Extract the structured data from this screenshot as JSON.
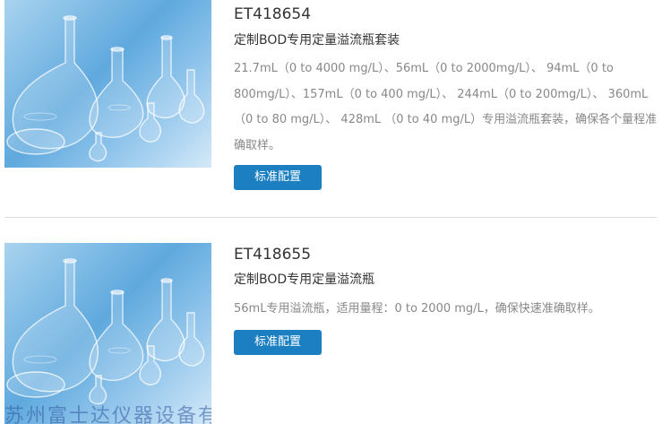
{
  "products": [
    {
      "code": "ET418654",
      "title": "定制BOD专用定量溢流瓶套装",
      "description": "21.7mL（0 to 4000 mg/L）、56mL（0 to 2000mg/L）、 94mL（0 to 800mg/L）、157mL（0 to 400 mg/L）、 244mL（0 to 200mg/L）、 360mL（0 to 80 mg/L）、 428mL （0 to 40 mg/L）专用溢流瓶套装，确保各个量程准确取样。",
      "button_label": "标准配置",
      "image_icon": "volumetric-flasks-image"
    },
    {
      "code": "ET418655",
      "title": "定制BOD专用定量溢流瓶",
      "description": "56mL专用溢流瓶，适用量程：0 to 2000 mg/L，确保快速准确取样。",
      "button_label": "标准配置",
      "image_icon": "volumetric-flasks-image"
    }
  ],
  "watermark": "苏州富士达仪器设备有",
  "colors": {
    "button": "#1b7fc1",
    "divider": "#dddddd",
    "description": "#888888",
    "heading": "#333333"
  }
}
